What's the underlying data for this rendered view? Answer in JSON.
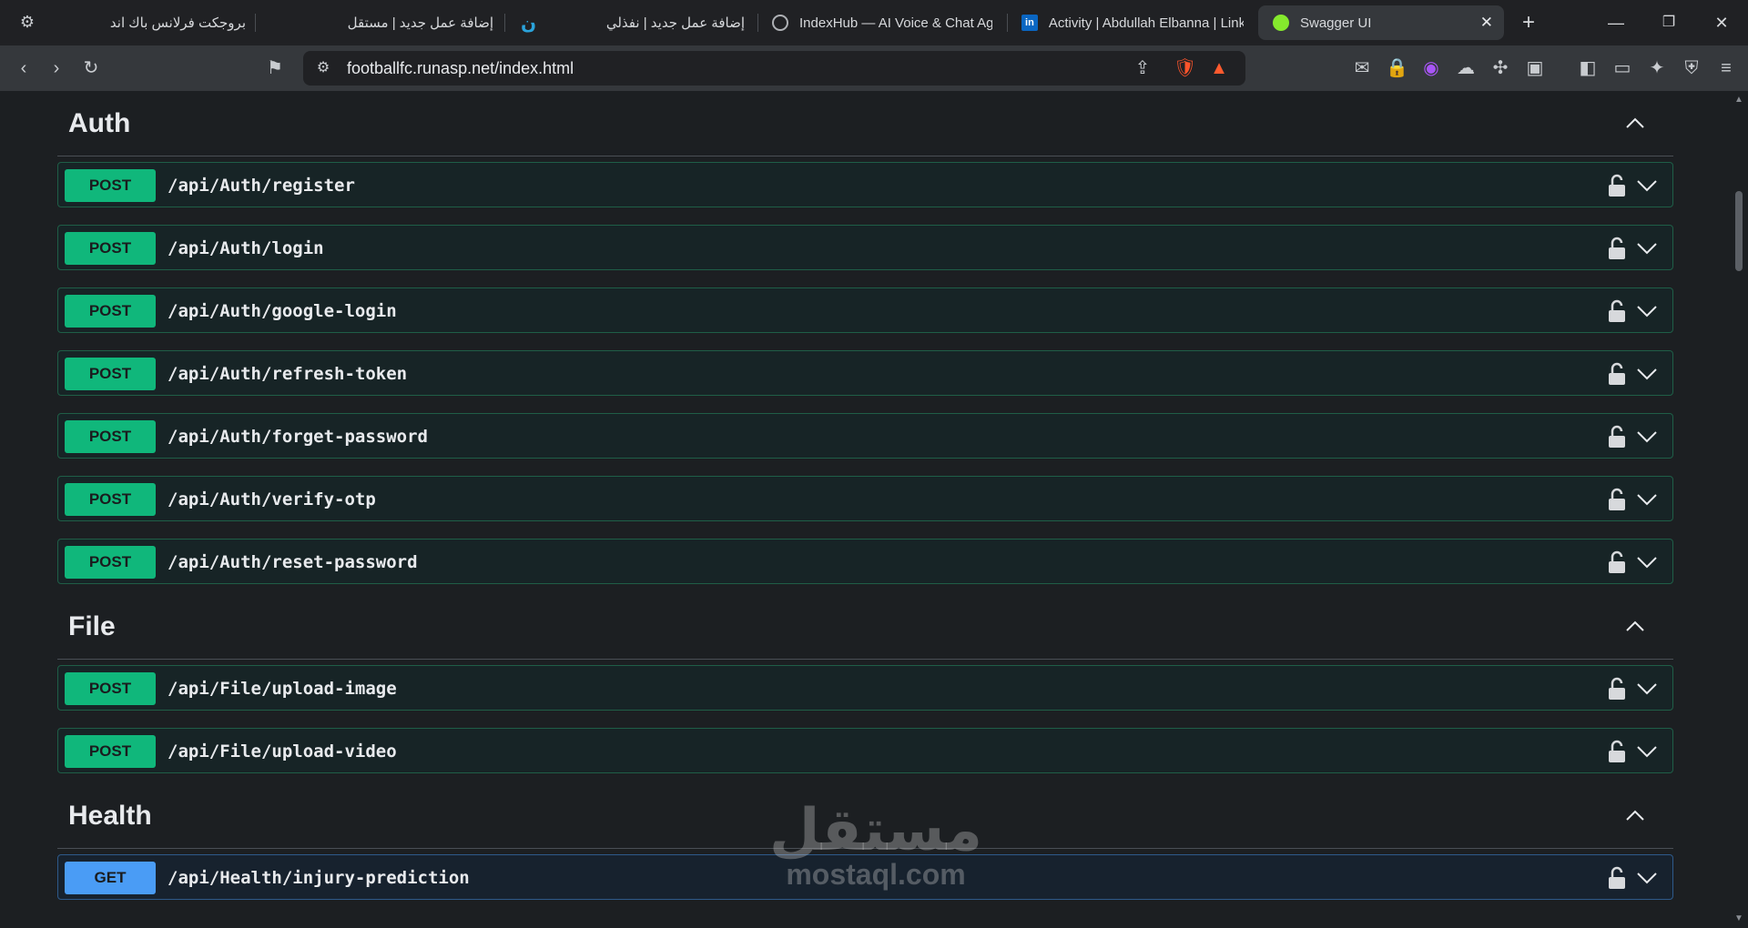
{
  "browser": {
    "tabs": [
      {
        "title": "بروجكت فرلانس باك اند",
        "icon": "openai-icon"
      },
      {
        "title": "إضافة عمل جديد | مستقل",
        "icon": "mostaql-icon"
      },
      {
        "title": "إضافة عمل جديد | نفذلي",
        "icon": "nafezly-icon"
      },
      {
        "title": "IndexHub — AI Voice & Chat Ag",
        "icon": "globe-icon"
      },
      {
        "title": "Activity | Abdullah Elbanna | Link",
        "icon": "linkedin-icon"
      },
      {
        "title": "Swagger UI",
        "icon": "swagger-icon",
        "active": true
      }
    ],
    "url": "footballfc.runasp.net/index.html"
  },
  "sections": [
    {
      "name": "Auth",
      "operations": [
        {
          "method": "POST",
          "path": "/api/Auth/register"
        },
        {
          "method": "POST",
          "path": "/api/Auth/login"
        },
        {
          "method": "POST",
          "path": "/api/Auth/google-login"
        },
        {
          "method": "POST",
          "path": "/api/Auth/refresh-token"
        },
        {
          "method": "POST",
          "path": "/api/Auth/forget-password"
        },
        {
          "method": "POST",
          "path": "/api/Auth/verify-otp"
        },
        {
          "method": "POST",
          "path": "/api/Auth/reset-password"
        }
      ]
    },
    {
      "name": "File",
      "operations": [
        {
          "method": "POST",
          "path": "/api/File/upload-image"
        },
        {
          "method": "POST",
          "path": "/api/File/upload-video"
        }
      ]
    },
    {
      "name": "Health",
      "operations": [
        {
          "method": "GET",
          "path": "/api/Health/injury-prediction"
        }
      ]
    }
  ],
  "watermark": {
    "arabic": "مستقل",
    "latin": "mostaql.com"
  },
  "colors": {
    "post": "#10b77b",
    "get": "#4a9cf5",
    "background": "#1c1f22"
  }
}
